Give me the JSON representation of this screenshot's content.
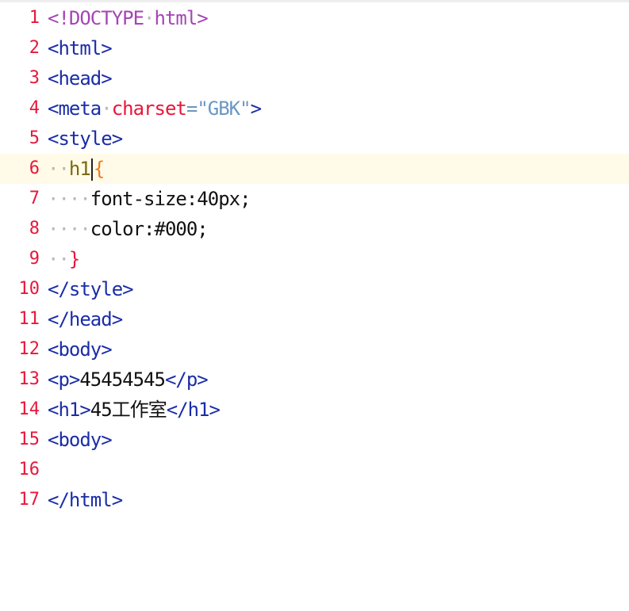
{
  "lines": [
    {
      "n": "1",
      "p": [
        "<!DOCTYPE",
        "·",
        "html>"
      ]
    },
    {
      "n": "2",
      "p": [
        "<html>"
      ]
    },
    {
      "n": "3",
      "p": [
        "<head>"
      ]
    },
    {
      "n": "4",
      "p": [
        "<meta",
        "·",
        "charset",
        "=",
        "\"GBK\"",
        ">"
      ]
    },
    {
      "n": "5",
      "p": [
        "<style>"
      ]
    },
    {
      "n": "6",
      "p": [
        "··",
        "h1",
        "{"
      ]
    },
    {
      "n": "7",
      "p": [
        "····",
        "font-size:40px;"
      ]
    },
    {
      "n": "8",
      "p": [
        "····",
        "color:#000;"
      ]
    },
    {
      "n": "9",
      "p": [
        "··",
        "}"
      ]
    },
    {
      "n": "10",
      "p": [
        "</style>"
      ]
    },
    {
      "n": "11",
      "p": [
        "</head>"
      ]
    },
    {
      "n": "12",
      "p": [
        "<body>"
      ]
    },
    {
      "n": "13",
      "p": [
        "<p>",
        "45454545",
        "</p>"
      ]
    },
    {
      "n": "14",
      "p": [
        "<h1>",
        "45工作室",
        "</h1>"
      ]
    },
    {
      "n": "15",
      "p": [
        "<body>"
      ]
    },
    {
      "n": "16",
      "p": []
    },
    {
      "n": "17",
      "p": [
        "</html>"
      ]
    }
  ]
}
